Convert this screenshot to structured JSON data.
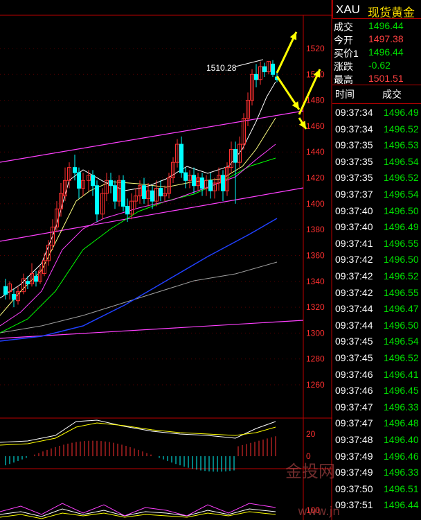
{
  "quote": {
    "symbol": "XAU",
    "name": "现货黄金",
    "rows": [
      {
        "label": "成交",
        "value": "1496.44",
        "color": "#00e000"
      },
      {
        "label": "今开",
        "value": "1497.38",
        "color": "#ff4040"
      },
      {
        "label": "买价1",
        "value": "1496.44",
        "color": "#00e000"
      },
      {
        "label": "涨跌",
        "value": "-0.62",
        "color": "#00e000"
      },
      {
        "label": "最高",
        "value": "1501.51",
        "color": "#ff4040"
      }
    ]
  },
  "ticks": {
    "header_time": "时间",
    "header_price": "成交",
    "rows": [
      {
        "time": "09:37:34",
        "price": "1496.49"
      },
      {
        "time": "09:37:34",
        "price": "1496.52"
      },
      {
        "time": "09:37:35",
        "price": "1496.53"
      },
      {
        "time": "09:37:35",
        "price": "1496.54"
      },
      {
        "time": "09:37:35",
        "price": "1496.52"
      },
      {
        "time": "09:37:37",
        "price": "1496.54"
      },
      {
        "time": "09:37:40",
        "price": "1496.50"
      },
      {
        "time": "09:37:40",
        "price": "1496.49"
      },
      {
        "time": "09:37:41",
        "price": "1496.55"
      },
      {
        "time": "09:37:42",
        "price": "1496.50"
      },
      {
        "time": "09:37:42",
        "price": "1496.52"
      },
      {
        "time": "09:37:42",
        "price": "1496.55"
      },
      {
        "time": "09:37:44",
        "price": "1496.47"
      },
      {
        "time": "09:37:44",
        "price": "1496.50"
      },
      {
        "time": "09:37:45",
        "price": "1496.54"
      },
      {
        "time": "09:37:45",
        "price": "1496.52"
      },
      {
        "time": "09:37:46",
        "price": "1496.41"
      },
      {
        "time": "09:37:46",
        "price": "1496.45"
      },
      {
        "time": "09:37:47",
        "price": "1496.33"
      },
      {
        "time": "09:37:47",
        "price": "1496.48"
      },
      {
        "time": "09:37:48",
        "price": "1496.40"
      },
      {
        "time": "09:37:49",
        "price": "1496.46"
      },
      {
        "time": "09:37:49",
        "price": "1496.33"
      },
      {
        "time": "09:37:50",
        "price": "1496.51"
      },
      {
        "time": "09:37:51",
        "price": "1496.44"
      }
    ]
  },
  "chart": {
    "price_axis": [
      "1520",
      "1500",
      "1480",
      "1460",
      "1440",
      "1420",
      "1400",
      "1380",
      "1360",
      "1340",
      "1320",
      "1300",
      "1280",
      "1260"
    ],
    "macd_axis": [
      "20",
      "0"
    ],
    "kdj_axis": [
      "100"
    ],
    "high_annotation": "1510.28",
    "colors": {
      "up_candle": "#ff3030",
      "down_candle": "#00ffff",
      "ma5": "#ffffff",
      "ma10": "#ffff80",
      "ma20": "#ff40ff",
      "ma30": "#00ff00",
      "ma60": "#2040ff",
      "ma120": "#a0a0a0",
      "channel": "#ff40ff",
      "arrow": "#ffff00"
    }
  },
  "watermark": "金投网",
  "watermark_url": "www.jn"
}
